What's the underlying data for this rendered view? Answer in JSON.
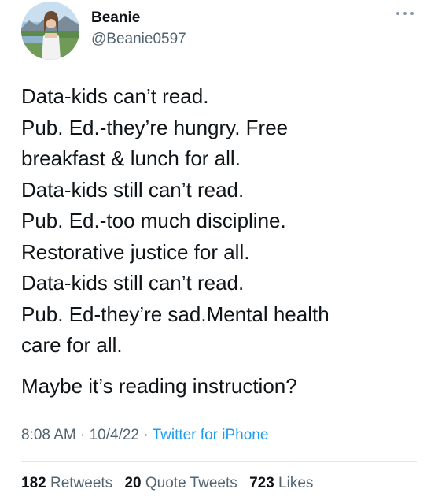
{
  "author": {
    "name": "Beanie",
    "handle": "@Beanie0597"
  },
  "tweet": {
    "lines": [
      "Data-kids can’t read.",
      "Pub. Ed.-they’re hungry. Free",
      "breakfast & lunch for all.",
      "Data-kids still can’t read.",
      "Pub. Ed.-too much discipline.",
      "Restorative justice for all.",
      "Data-kids still can’t read.",
      "Pub. Ed-they’re sad.Mental health",
      "care for all."
    ],
    "closing": "Maybe it’s reading instruction?"
  },
  "meta": {
    "time": "8:08 AM",
    "separator": "·",
    "date": "10/4/22",
    "source": "Twitter for iPhone"
  },
  "stats": {
    "retweets_count": "182",
    "retweets_label": "Retweets",
    "quotes_count": "20",
    "quotes_label": "Quote Tweets",
    "likes_count": "723",
    "likes_label": "Likes"
  },
  "colors": {
    "text": "#0f1419",
    "secondary": "#536471",
    "link": "#1d9bf0",
    "divider": "#e1e8ed"
  }
}
